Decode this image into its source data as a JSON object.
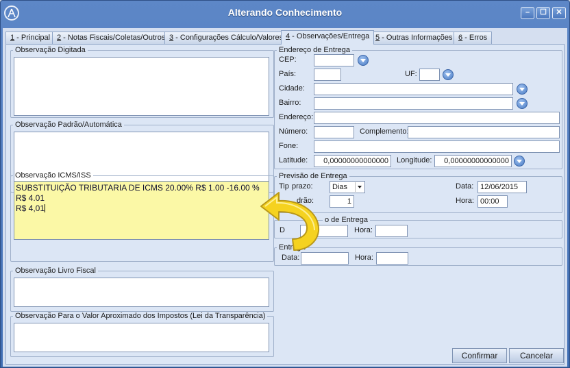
{
  "window": {
    "title": "Alterando Conhecimento"
  },
  "colors": {
    "titlebar": "#4a77bd",
    "highlight_field": "#fbf8a6",
    "arrow": "#f5d21f"
  },
  "tabs": [
    {
      "key": "1",
      "label": " - Principal"
    },
    {
      "key": "2",
      "label": " - Notas Fiscais/Coletas/Outros"
    },
    {
      "key": "3",
      "label": " - Configurações Cálculo/Valores"
    },
    {
      "key": "4",
      "label": " - Observações/Entrega"
    },
    {
      "key": "5",
      "label": " - Outras Informações"
    },
    {
      "key": "6",
      "label": " - Erros"
    }
  ],
  "groups": {
    "obs_digitada": "Observação Digitada",
    "obs_padrao": "Observação Padrão/Automática",
    "obs_icms": "Observação ICMS/ISS",
    "obs_livro": "Observação Livro Fiscal",
    "obs_impostos": "Observação Para o Valor Aproximado dos Impostos (Lei da Transparência)",
    "endereco": "Endereço de Entrega",
    "previsao": "Previsão de Entrega",
    "agendamento": "o de Entrega",
    "entrega": "Entrega"
  },
  "icms_text": {
    "line1": "SUBSTITUIÇÃO TRIBUTARIA DE ICMS 20.00% R$ 1.00 -16.00 % R$ 4.01",
    "line2": "R$ 4,01"
  },
  "endereco": {
    "cep_label": "CEP:",
    "pais_label": "País:",
    "uf_label": "UF:",
    "cidade_label": "Cidade:",
    "bairro_label": "Bairro:",
    "endereco_label": "Endereço:",
    "numero_label": "Número:",
    "complemento_label": "Complemento:",
    "fone_label": "Fone:",
    "latitude_label": "Latitude:",
    "latitude_value": "0,00000000000000",
    "longitude_label": "Longitude:",
    "longitude_value": "0,00000000000000"
  },
  "previsao": {
    "tipo_prazo_label": "Tip",
    "tipo_prazo_label2": "prazo:",
    "tipo_prazo_value": "Dias",
    "padrao_label": "drão:",
    "padrao_value": "1",
    "data_label": "Data:",
    "data_value": "12/06/2015",
    "hora_label": "Hora:",
    "hora_value": "00:00"
  },
  "agendamento": {
    "data_label": "D",
    "hora_label": "Hora:"
  },
  "entrega": {
    "data_label": "Data:",
    "hora_label": "Hora:"
  },
  "buttons": {
    "confirmar": "Confirmar",
    "cancelar": "Cancelar"
  }
}
